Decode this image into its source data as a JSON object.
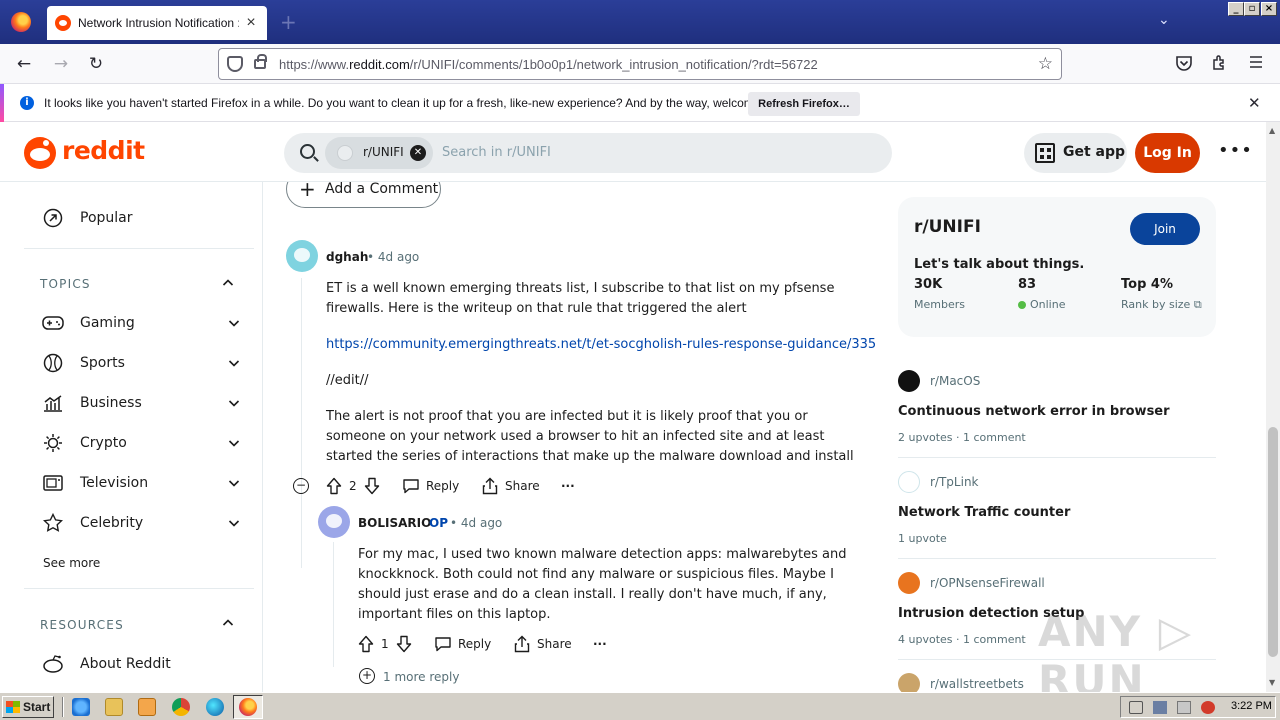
{
  "browser": {
    "tab_title": "Network Intrusion Notification : r/U",
    "url_prefix": "https://www.",
    "url_domain": "reddit.com",
    "url_path": "/r/UNIFI/comments/1b0o0p1/network_intrusion_notification/?rdt=56722",
    "notification_text": "It looks like you haven't started Firefox in a while. Do you want to clean it up for a fresh, like-new experience? And by the way, welcome back!",
    "notification_button": "Refresh Firefox…"
  },
  "header": {
    "wordmark": "reddit",
    "search_chip": "r/UNIFI",
    "search_placeholder": "Search in r/UNIFI",
    "get_app": "Get app",
    "login": "Log In"
  },
  "sidebar": {
    "popular": "Popular",
    "topics_heading": "TOPICS",
    "topics": [
      {
        "label": "Gaming",
        "icon": "gamepad-icon"
      },
      {
        "label": "Sports",
        "icon": "ball-icon"
      },
      {
        "label": "Business",
        "icon": "chart-icon"
      },
      {
        "label": "Crypto",
        "icon": "crypto-icon"
      },
      {
        "label": "Television",
        "icon": "tv-icon"
      },
      {
        "label": "Celebrity",
        "icon": "star-icon"
      }
    ],
    "see_more": "See more",
    "resources_heading": "RESOURCES",
    "about": "About Reddit"
  },
  "main": {
    "add_comment": "Add a Comment",
    "comment1": {
      "author": "dghah",
      "time": "• 4d ago",
      "p1": "ET is a well known emerging threats list, I subscribe to that list on my pfsense firewalls. Here is the writeup on that rule that triggered the alert",
      "link": "https://community.emergingthreats.net/t/et-socgholish-rules-response-guidance/335",
      "p2": "//edit//",
      "p3": "The alert is not proof that you are infected but it is likely proof that you or someone on your network used a browser to hit an infected site and at least started the series of interactions that make up the malware download and install",
      "votes": "2",
      "reply": "Reply",
      "share": "Share",
      "more": "···"
    },
    "comment2": {
      "author": "BOLISARIO",
      "op": "OP",
      "time": "• 4d ago",
      "text": "For my mac, I used two known malware detection apps: malwarebytes and knockknock. Both could not find any malware or suspicious files. Maybe I should just erase and do a clean install. I really don't have much, if any, important files on this laptop.",
      "votes": "1",
      "reply": "Reply",
      "share": "Share",
      "more": "···"
    },
    "more_reply": "1 more reply"
  },
  "right": {
    "sub_name": "r/UNIFI",
    "join": "Join",
    "description": "Let's talk about things.",
    "members_value": "30K",
    "members_label": "Members",
    "online_value": "83",
    "online_label": "Online",
    "rank_value": "Top 4%",
    "rank_label": "Rank by size",
    "related": [
      {
        "sub": "r/MacOS",
        "title": "Continuous network error in browser",
        "meta": "2 upvotes  ·  1 comment"
      },
      {
        "sub": "r/TpLink",
        "title": "Network Traffic counter",
        "meta": "1 upvote"
      },
      {
        "sub": "r/OPNsenseFirewall",
        "title": "Intrusion detection setup",
        "meta": "4 upvotes  ·  1 comment"
      },
      {
        "sub": "r/wallstreetbets",
        "title": "",
        "meta": ""
      }
    ],
    "watermark": "ANY ▷ RUN"
  },
  "taskbar": {
    "start": "Start",
    "time": "3:22 PM"
  },
  "colors": {
    "reddit_orange": "#ff4500",
    "login_bg": "#d93900",
    "join_bg": "#0a449b",
    "link": "#0045ac",
    "online": "#55bd46"
  }
}
